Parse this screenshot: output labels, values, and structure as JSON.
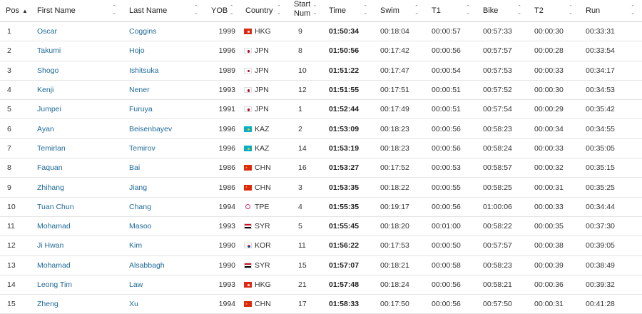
{
  "columns": {
    "pos": "Pos",
    "first_name": "First Name",
    "last_name": "Last Name",
    "yob": "YOB",
    "country": "Country",
    "start_num": "Start Num",
    "time": "Time",
    "swim": "Swim",
    "t1": "T1",
    "bike": "Bike",
    "t2": "T2",
    "run": "Run"
  },
  "icons": {
    "sort_ascending": "caret-up-icon",
    "sortable": "sort-up-down-icon"
  },
  "colors": {
    "link": "#1f6a99",
    "header_border": "#cfcfcf",
    "row_border": "#e4e4e4"
  },
  "rows": [
    {
      "pos": "1",
      "first": "Oscar",
      "last": "Coggins",
      "yob": "1999",
      "flag": "hkg",
      "country": "HKG",
      "start": "9",
      "time": "01:50:34",
      "swim": "00:18:04",
      "t1": "00:00:57",
      "bike": "00:57:33",
      "t2": "00:00:30",
      "run": "00:33:31"
    },
    {
      "pos": "2",
      "first": "Takumi",
      "last": "Hojo",
      "yob": "1996",
      "flag": "jpn",
      "country": "JPN",
      "start": "8",
      "time": "01:50:56",
      "swim": "00:17:42",
      "t1": "00:00:56",
      "bike": "00:57:57",
      "t2": "00:00:28",
      "run": "00:33:54"
    },
    {
      "pos": "3",
      "first": "Shogo",
      "last": "Ishitsuka",
      "yob": "1989",
      "flag": "jpn",
      "country": "JPN",
      "start": "10",
      "time": "01:51:22",
      "swim": "00:17:47",
      "t1": "00:00:54",
      "bike": "00:57:53",
      "t2": "00:00:33",
      "run": "00:34:17"
    },
    {
      "pos": "4",
      "first": "Kenji",
      "last": "Nener",
      "yob": "1993",
      "flag": "jpn",
      "country": "JPN",
      "start": "12",
      "time": "01:51:55",
      "swim": "00:17:51",
      "t1": "00:00:51",
      "bike": "00:57:52",
      "t2": "00:00:30",
      "run": "00:34:53"
    },
    {
      "pos": "5",
      "first": "Jumpei",
      "last": "Furuya",
      "yob": "1991",
      "flag": "jpn",
      "country": "JPN",
      "start": "1",
      "time": "01:52:44",
      "swim": "00:17:49",
      "t1": "00:00:51",
      "bike": "00:57:54",
      "t2": "00:00:29",
      "run": "00:35:42"
    },
    {
      "pos": "6",
      "first": "Ayan",
      "last": "Beisenbayev",
      "yob": "1996",
      "flag": "kaz",
      "country": "KAZ",
      "start": "2",
      "time": "01:53:09",
      "swim": "00:18:23",
      "t1": "00:00:56",
      "bike": "00:58:23",
      "t2": "00:00:34",
      "run": "00:34:55"
    },
    {
      "pos": "7",
      "first": "Temirlan",
      "last": "Temirov",
      "yob": "1996",
      "flag": "kaz",
      "country": "KAZ",
      "start": "14",
      "time": "01:53:19",
      "swim": "00:18:23",
      "t1": "00:00:56",
      "bike": "00:58:24",
      "t2": "00:00:33",
      "run": "00:35:05"
    },
    {
      "pos": "8",
      "first": "Faquan",
      "last": "Bai",
      "yob": "1986",
      "flag": "chn",
      "country": "CHN",
      "start": "16",
      "time": "01:53:27",
      "swim": "00:17:52",
      "t1": "00:00:53",
      "bike": "00:58:57",
      "t2": "00:00:32",
      "run": "00:35:15"
    },
    {
      "pos": "9",
      "first": "Zhihang",
      "last": "Jiang",
      "yob": "1986",
      "flag": "chn",
      "country": "CHN",
      "start": "3",
      "time": "01:53:35",
      "swim": "00:18:22",
      "t1": "00:00:55",
      "bike": "00:58:25",
      "t2": "00:00:31",
      "run": "00:35:25"
    },
    {
      "pos": "10",
      "first": "Tuan Chun",
      "last": "Chang",
      "yob": "1994",
      "flag": "tpe",
      "country": "TPE",
      "start": "4",
      "time": "01:55:35",
      "swim": "00:19:17",
      "t1": "00:00:56",
      "bike": "01:00:06",
      "t2": "00:00:33",
      "run": "00:34:44"
    },
    {
      "pos": "11",
      "first": "Mohamad",
      "last": "Masoo",
      "yob": "1993",
      "flag": "syr",
      "country": "SYR",
      "start": "5",
      "time": "01:55:45",
      "swim": "00:18:20",
      "t1": "00:01:00",
      "bike": "00:58:22",
      "t2": "00:00:35",
      "run": "00:37:30"
    },
    {
      "pos": "12",
      "first": "Ji Hwan",
      "last": "Kim",
      "yob": "1990",
      "flag": "kor",
      "country": "KOR",
      "start": "11",
      "time": "01:56:22",
      "swim": "00:17:53",
      "t1": "00:00:50",
      "bike": "00:57:57",
      "t2": "00:00:38",
      "run": "00:39:05"
    },
    {
      "pos": "13",
      "first": "Mohamad",
      "last": "Alsabbagh",
      "yob": "1990",
      "flag": "syr",
      "country": "SYR",
      "start": "15",
      "time": "01:57:07",
      "swim": "00:18:21",
      "t1": "00:00:58",
      "bike": "00:58:23",
      "t2": "00:00:39",
      "run": "00:38:49"
    },
    {
      "pos": "14",
      "first": "Leong Tim",
      "last": "Law",
      "yob": "1993",
      "flag": "hkg",
      "country": "HKG",
      "start": "21",
      "time": "01:57:48",
      "swim": "00:18:24",
      "t1": "00:00:56",
      "bike": "00:58:21",
      "t2": "00:00:36",
      "run": "00:39:32"
    },
    {
      "pos": "15",
      "first": "Zheng",
      "last": "Xu",
      "yob": "1994",
      "flag": "chn",
      "country": "CHN",
      "start": "17",
      "time": "01:58:33",
      "swim": "00:17:50",
      "t1": "00:00:56",
      "bike": "00:57:50",
      "t2": "00:00:31",
      "run": "00:41:28"
    }
  ]
}
